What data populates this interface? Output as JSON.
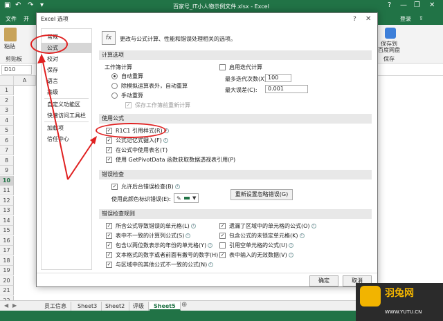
{
  "window": {
    "title": "百家号_IT小人物示例文件.xlsx - Excel",
    "controls": [
      "?",
      "—",
      "❐",
      "✕"
    ]
  },
  "quick_access": {
    "icons": [
      "save-icon",
      "undo-icon",
      "redo-icon",
      "customize-icon"
    ]
  },
  "ribbon": {
    "tabs": [
      "文件",
      "开"
    ],
    "login": "登录",
    "share_icon": "share-icon",
    "labels": {
      "paste": "粘贴",
      "clipboard": "剪贴板",
      "save_to_line1": "保存到",
      "save_to_line2": "百度网盘",
      "save": "保存"
    }
  },
  "formula_bar": {
    "name_box": "D10"
  },
  "grid": {
    "columns": [
      "A"
    ],
    "rows": [
      "1",
      "2",
      "3",
      "4",
      "5",
      "6",
      "7",
      "8",
      "9",
      "10",
      "11",
      "12",
      "13",
      "14",
      "15",
      "16",
      "17",
      "18",
      "19",
      "20",
      "21",
      "22"
    ],
    "selected_row": "10"
  },
  "sheet_tabs": {
    "tabs": [
      "员工信息",
      "Sheet3",
      "Sheet2",
      "评级",
      "Sheet5"
    ],
    "active": "Sheet5"
  },
  "dialog": {
    "title": "Excel 选项",
    "help": "?",
    "close": "✕",
    "nav": [
      "常规",
      "公式",
      "校对",
      "保存",
      "语言",
      "高级",
      "自定义功能区",
      "快速访问工具栏",
      "加载项",
      "信任中心"
    ],
    "nav_active": "公式",
    "intro": "更改与公式计算、性能和错误处理相关的选项。",
    "sections": {
      "calc": "计算选项",
      "formulas": "使用公式",
      "errcheck": "错误检查",
      "rules": "错误检查规则"
    },
    "calc": {
      "workbook_calc": "工作簿计算",
      "auto": "自动重算",
      "auto_except": "除模拟运算表外，自动重算",
      "manual": "手动重算",
      "recalc_before_save": "保存工作簿前重新计算",
      "enable_iterative": "启用迭代计算",
      "max_iter_label": "最多迭代次数(X):",
      "max_iter_value": "100",
      "max_change_label": "最大误差(C):",
      "max_change_value": "0.001"
    },
    "formulas": {
      "r1c1": "R1C1 引用样式(R)",
      "autocomplete": "公式记忆式键入(F)",
      "table_names": "在公式中使用表名(T)",
      "getpivot": "使用 GetPivotData 函数获取数据透视表引用(P)"
    },
    "errcheck": {
      "background": "允许后台错误检查(B)",
      "color_label": "使用此颜色标识错误(E):",
      "reset_button": "重新设置忽略错误(G)"
    },
    "rules": [
      "所含公式导致错误的单元格(L)",
      "表中不一致的计算列公式(S)",
      "包含以两位数表示的年份的单元格(Y)",
      "文本格式的数字或者前面有撇号的数字(H)",
      "与区域中的其他公式不一致的公式(N)",
      "遗漏了区域中的单元格的公式(O)",
      "包含公式的未锁定单元格(K)",
      "引用空单元格的公式(U)",
      "表中输入的无效数据(V)"
    ],
    "ok": "确定",
    "cancel": "取消"
  },
  "watermark": {
    "brand": "羽兔网",
    "url": "WWW.YUTU.CN"
  },
  "colors": {
    "excel_green": "#217346",
    "annotation_red": "#e02020"
  }
}
